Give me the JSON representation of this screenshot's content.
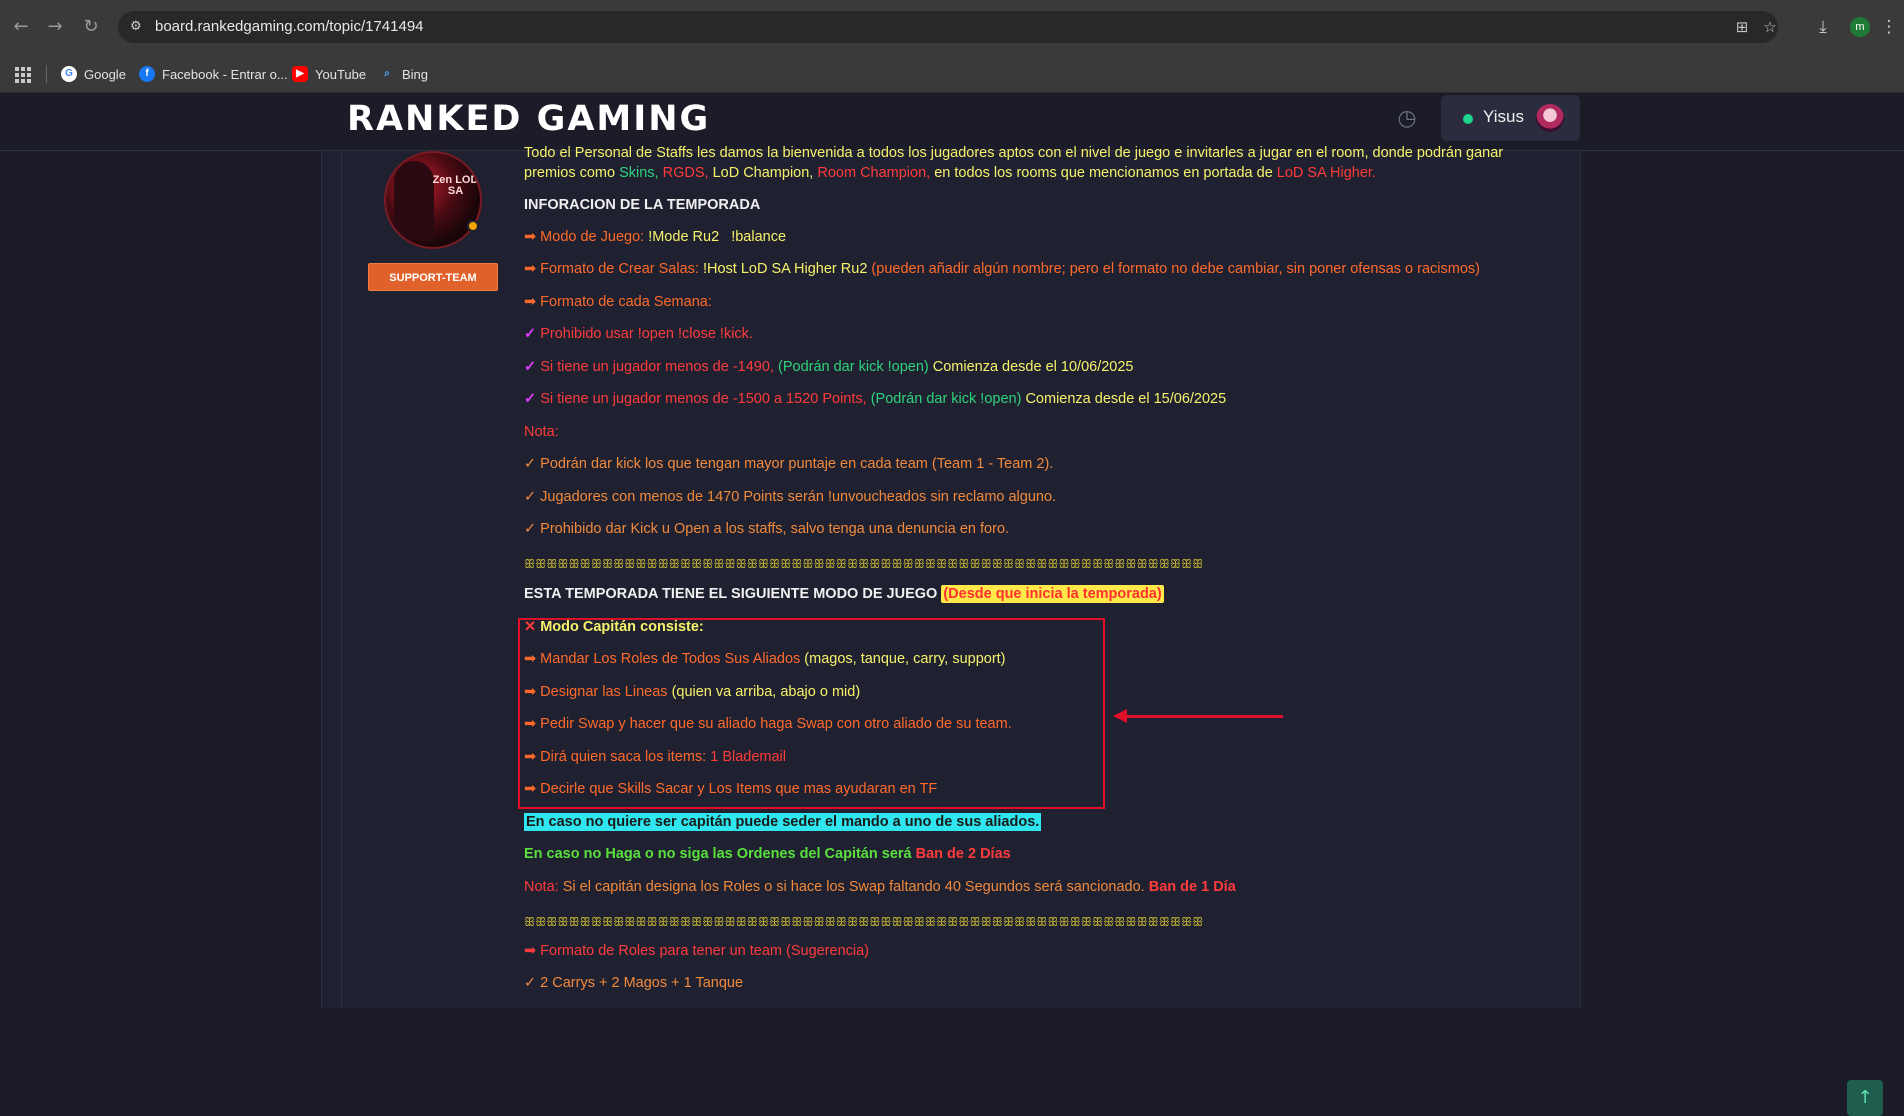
{
  "browser": {
    "url": "board.rankedgaming.com/topic/1741494",
    "bookmarks": [
      {
        "label": "Google",
        "icon": "google-icon"
      },
      {
        "label": "Facebook - Entrar o...",
        "icon": "facebook-icon"
      },
      {
        "label": "YouTube",
        "icon": "youtube-icon"
      },
      {
        "label": "Bing",
        "icon": "bing-icon"
      }
    ],
    "profile_initial": "m"
  },
  "site": {
    "logo": "RANKED GAMING",
    "user_name": "Yisus"
  },
  "author": {
    "avatar_text": "Zen LOD SA",
    "role_button": "SUPPORT-TEAM"
  },
  "post": {
    "intro_1": "Todo el Personal de Staffs les damos la bienvenida a todos los jugadores aptos con el nivel de juego e invitarles a jugar en el room, donde podrán ganar",
    "intro_2a": "premios como",
    "intro_skins": "Skins,",
    "intro_rgds": "RGDS,",
    "intro_lodchamp": "LoD Champion,",
    "intro_roomchamp": "Room Champion,",
    "intro_2b": "en todos los rooms que mencionamos en portada de",
    "intro_lodsa": "LoD SA Higher.",
    "info_title": "INFORACION DE LA TEMPORADA",
    "modo_label": "➡ Modo de Juego:",
    "modo_value": "!Mode Ru2   !balance",
    "formato_label": "➡ Formato de Crear Salas:",
    "formato_value": "!Host LoD SA Higher Ru2",
    "formato_note": "(pueden añadir algún nombre; pero el formato no debe cambiar, sin poner ofensas o racismos)",
    "semana_label": "➡ Formato de cada Semana:",
    "rule1": "Prohibido usar !open !close !kick.",
    "rule2a": "Si tiene un jugador menos de -1490,",
    "rule2b": "(Podrán dar kick !open)",
    "rule2c": "Comienza desde el 10/06/2025",
    "rule3a": "Si tiene un jugador menos de -1500 a 1520 Points,",
    "rule3b": "(Podrán dar kick !open)",
    "rule3c": "Comienza desde el 15/06/2025",
    "nota_label": "Nota:",
    "nota1": "✓ Podrán dar kick los que tengan mayor puntaje en cada team (Team 1 - Team 2).",
    "nota2": "✓ Jugadores con menos de 1470 Points serán !unvoucheados sin reclamo alguno.",
    "nota3": "✓ Prohibido dar Kick u Open a los staffs, salvo tenga una denuncia en foro.",
    "divider": "ꕥꕥꕥꕥꕥꕥꕥꕥꕥꕥꕥꕥꕥꕥꕥꕥꕥꕥꕥꕥꕥꕥꕥꕥꕥꕥꕥꕥꕥꕥꕥꕥꕥꕥꕥꕥꕥꕥꕥꕥꕥꕥꕥꕥꕥꕥꕥꕥꕥꕥꕥꕥꕥꕥꕥꕥꕥꕥꕥꕥꕥꕥꕥꕥꕥꕥꕥꕥꕥꕥꕥꕥꕥꕥꕥꕥꕥꕥꕥꕥꕥꕥꕥꕥꕥꕥꕥꕥꕥꕥꕥꕥꕥꕥꕥꕥꕥꕥꕥꕥꕥꕥꕥꕥꕥꕥꕥꕥꕥꕥꕥꕥꕥꕥꕥꕥꕥꕥꕥꕥꕥꕥꕥꕥꕥꕥꕥꕥꕥꕥꕥꕥꕥꕥꕥꕥꕥꕥꕥꕥꕥꕥꕥꕥꕥꕥꕥꕥꕥꕥꕥꕥꕥꕥꕥꕥꕥꕥꕥꕥꕥꕥ",
    "temporada_title": "ESTA TEMPORADA TIENE EL SIGUIENTE MODO DE JUEGO",
    "temporada_hl": "(Desde que inicia la temporada)",
    "cap_title": "Modo Capitán consiste:",
    "cap1a": "➡ Mandar Los Roles de Todos Sus Aliados",
    "cap1b": "(magos, tanque, carry, support)",
    "cap2a": "➡ Designar las Lineas",
    "cap2b": "(quien va arriba, abajo o mid)",
    "cap3": "➡ Pedir Swap y hacer que su aliado haga Swap con otro aliado de su team.",
    "cap4a": "➡ Dirá quien saca los items:",
    "cap4b": "1 Blademail",
    "cap5": "➡ Decirle que Skills Sacar y Los Items que mas ayudaran en TF",
    "cyan_line": "En caso no quiere ser capitán puede seder el mando a uno de sus aliados.",
    "ban2a": "En caso no Haga o no siga las Ordenes del Capitán será",
    "ban2b": "Ban de 2 Días",
    "nota2_label": "Nota:",
    "nota2_text": "Si el capitán designa los Roles o si hace los Swap faltando 40 Segundos será sancionado.",
    "ban1": "Ban de 1 Día",
    "roles_title": "➡ Formato de Roles para tener un team (Sugerencia)",
    "roles1": "✓ 2 Carrys + 2 Magos + 1 Tanque"
  },
  "colors": {
    "accent_red": "#e0102a",
    "support_orange": "#e0622a",
    "online_green": "#1ed48a"
  }
}
